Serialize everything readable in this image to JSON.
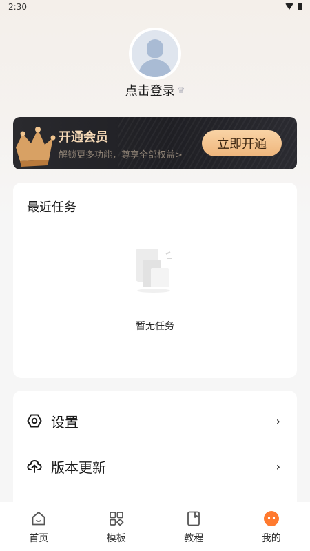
{
  "status_bar": {
    "time": "2:30"
  },
  "profile": {
    "login_text": "点击登录",
    "crown_glyph": "♛"
  },
  "vip": {
    "title": "开通会员",
    "subtitle": "解锁更多功能，尊享全部权益>",
    "button": "立即开通",
    "accent_color": "#f6d9b6"
  },
  "tasks": {
    "title": "最近任务",
    "empty_text": "暂无任务"
  },
  "menu": {
    "items": [
      {
        "label": "设置",
        "icon": "settings-icon",
        "chevron": "›"
      },
      {
        "label": "版本更新",
        "icon": "upload-cloud-icon",
        "chevron": "›"
      }
    ]
  },
  "nav": {
    "items": [
      {
        "label": "首页",
        "icon": "home-icon",
        "active": false
      },
      {
        "label": "模板",
        "icon": "grid-icon",
        "active": false
      },
      {
        "label": "教程",
        "icon": "book-icon",
        "active": false
      },
      {
        "label": "我的",
        "icon": "profile-face-icon",
        "active": true
      }
    ],
    "active_color": "#ff7a2f"
  }
}
